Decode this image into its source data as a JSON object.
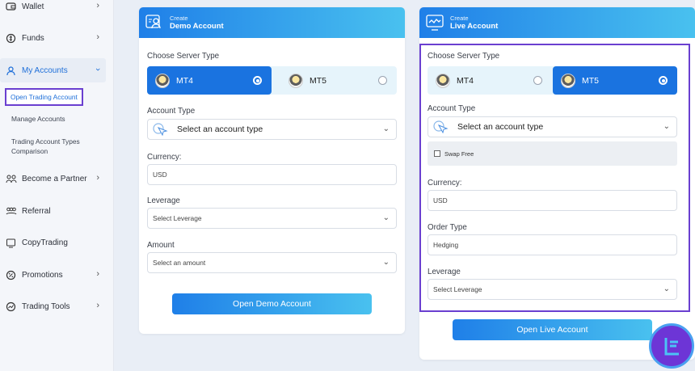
{
  "sidebar": {
    "items": [
      {
        "label": "Wallet",
        "icon": "wallet-icon"
      },
      {
        "label": "Funds",
        "icon": "funds-icon"
      },
      {
        "label": "My Accounts",
        "icon": "accounts-icon"
      },
      {
        "label": "Become a Partner",
        "icon": "partner-icon"
      },
      {
        "label": "Referral",
        "icon": "referral-icon"
      },
      {
        "label": "CopyTrading",
        "icon": "copytrading-icon"
      },
      {
        "label": "Promotions",
        "icon": "promotions-icon"
      },
      {
        "label": "Trading Tools",
        "icon": "trading-tools-icon"
      }
    ],
    "sub_items": [
      "Open Trading Account",
      "Manage Accounts",
      "Trading Account Types Comparison"
    ]
  },
  "demo": {
    "header_small": "Create",
    "header_big": "Demo Account",
    "server_label": "Choose Server Type",
    "servers": [
      "MT4",
      "MT5"
    ],
    "selected_server": "MT4",
    "account_type_label": "Account Type",
    "account_type_value": "Select an account type",
    "currency_label": "Currency:",
    "currency_value": "USD",
    "leverage_label": "Leverage",
    "leverage_value": "Select Leverage",
    "amount_label": "Amount",
    "amount_value": "Select an amount",
    "button": "Open Demo Account"
  },
  "live": {
    "header_small": "Create",
    "header_big": "Live Account",
    "server_label": "Choose Server Type",
    "servers": [
      "MT4",
      "MT5"
    ],
    "selected_server": "MT5",
    "account_type_label": "Account Type",
    "account_type_value": "Select an account type",
    "swap_free": "Swap Free",
    "currency_label": "Currency:",
    "currency_value": "USD",
    "order_type_label": "Order Type",
    "order_type_value": "Hedging",
    "leverage_label": "Leverage",
    "leverage_value": "Select Leverage",
    "button": "Open Live Account"
  },
  "colors": {
    "accent": "#1a73e0",
    "highlight": "#6a3fd0",
    "gradient_end": "#49c1ef"
  }
}
